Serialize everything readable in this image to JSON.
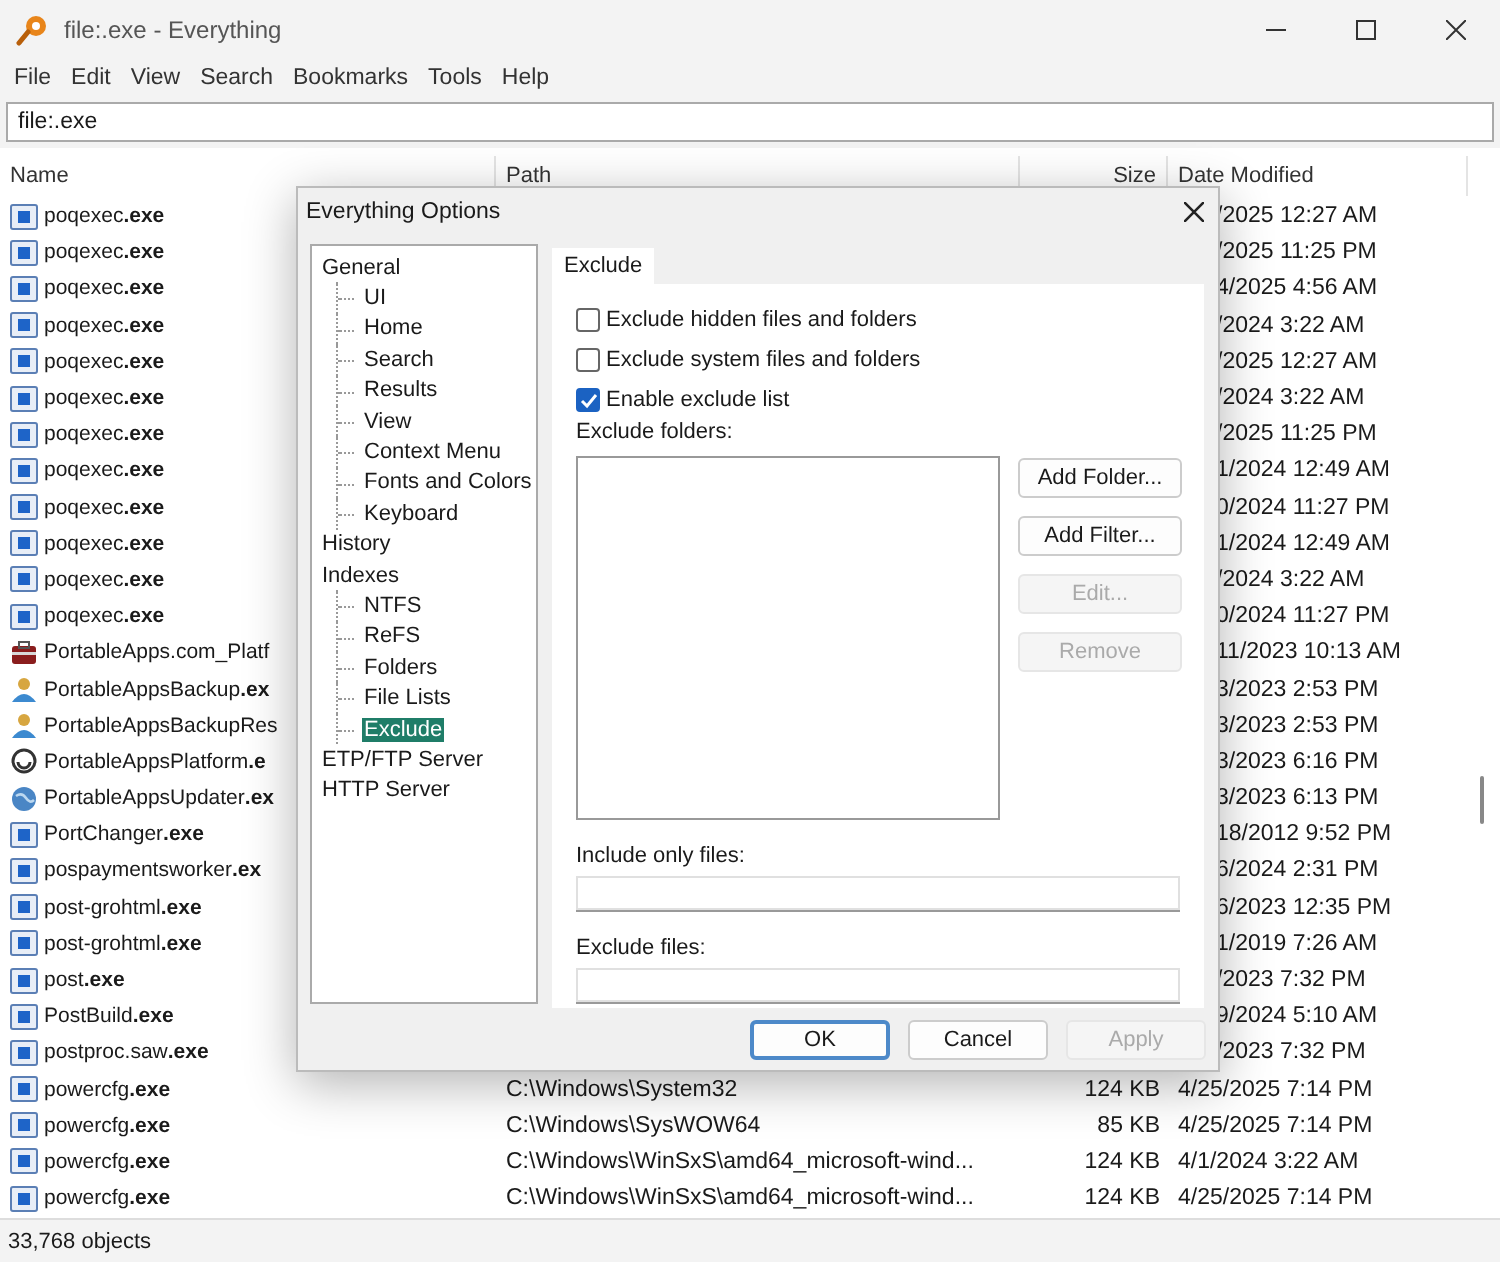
{
  "window": {
    "title": "file:.exe - Everything"
  },
  "menu": [
    "File",
    "Edit",
    "View",
    "Search",
    "Bookmarks",
    "Tools",
    "Help"
  ],
  "search": {
    "value": "file:.exe"
  },
  "columns": [
    "Name",
    "Path",
    "Size",
    "Date Modified"
  ],
  "rows": [
    {
      "kind": "exe",
      "name": "poqexec**.exe**",
      "date": "/2025 12:27 AM"
    },
    {
      "kind": "exe",
      "name": "poqexec**.exe**",
      "date": "/2025 11:25 PM"
    },
    {
      "kind": "exe",
      "name": "poqexec**.exe**",
      "date": "4/2025 4:56 AM"
    },
    {
      "kind": "exe",
      "name": "poqexec**.exe**",
      "date": "/2024 3:22 AM"
    },
    {
      "kind": "exe",
      "name": "poqexec**.exe**",
      "date": "/2025 12:27 AM"
    },
    {
      "kind": "exe",
      "name": "poqexec**.exe**",
      "date": "/2024 3:22 AM"
    },
    {
      "kind": "exe",
      "name": "poqexec**.exe**",
      "date": "/2025 11:25 PM"
    },
    {
      "kind": "exe",
      "name": "poqexec**.exe**",
      "date": "1/2024 12:49 AM"
    },
    {
      "kind": "exe",
      "name": "poqexec**.exe**",
      "date": "0/2024 11:27 PM"
    },
    {
      "kind": "exe",
      "name": "poqexec**.exe**",
      "date": "1/2024 12:49 AM"
    },
    {
      "kind": "exe",
      "name": "poqexec**.exe**",
      "date": "/2024 3:22 AM"
    },
    {
      "kind": "exe",
      "name": "poqexec**.exe**",
      "date": "0/2024 11:27 PM"
    },
    {
      "kind": "suitcase",
      "name": "PortableApps.com_Platf",
      "date": "11/2023 10:13 AM"
    },
    {
      "kind": "person",
      "name": "PortableAppsBackup**.ex**",
      "date": "3/2023 2:53 PM"
    },
    {
      "kind": "person",
      "name": "PortableAppsBackupRes",
      "date": "3/2023 2:53 PM"
    },
    {
      "kind": "ring",
      "name": "PortableAppsPlatform**.e**",
      "date": "3/2023 6:16 PM"
    },
    {
      "kind": "globe",
      "name": "PortableAppsUpdater**.ex**",
      "date": "3/2023 6:13 PM"
    },
    {
      "kind": "exe",
      "name": "PortChanger**.exe**",
      "date": "18/2012 9:52 PM"
    },
    {
      "kind": "exe",
      "name": "pospaymentsworker**.ex**",
      "date": "6/2024 2:31 PM"
    },
    {
      "kind": "exe",
      "name": "post-grohtml**.exe**",
      "date": "6/2023 12:35 PM"
    },
    {
      "kind": "exe",
      "name": "post-grohtml**.exe**",
      "date": "1/2019 7:26 AM"
    },
    {
      "kind": "exe",
      "name": "post**.exe**",
      "date": "/2023 7:32 PM"
    },
    {
      "kind": "exe",
      "name": "PostBuild**.exe**",
      "date": "9/2024 5:10 AM"
    },
    {
      "kind": "exe",
      "name": "postproc.saw**.exe**",
      "date": "/2023 7:32 PM"
    },
    {
      "kind": "exe",
      "name": "powercfg**.exe**",
      "path": "C:\\Windows\\System32",
      "size": "124 KB",
      "date": "4/25/2025 7:14 PM"
    },
    {
      "kind": "exe",
      "name": "powercfg**.exe**",
      "path": "C:\\Windows\\SysWOW64",
      "size": "85 KB",
      "date": "4/25/2025 7:14 PM"
    },
    {
      "kind": "exe",
      "name": "powercfg**.exe**",
      "path": "C:\\Windows\\WinSxS\\amd64_microsoft-wind...",
      "size": "124 KB",
      "date": "4/1/2024 3:22 AM"
    },
    {
      "kind": "exe",
      "name": "powercfg**.exe**",
      "path": "C:\\Windows\\WinSxS\\amd64_microsoft-wind...",
      "size": "124 KB",
      "date": "4/25/2025 7:14 PM"
    }
  ],
  "status_bar": "33,768 objects",
  "dialog": {
    "title": "Everything Options",
    "tree": [
      {
        "label": "General",
        "selected": false,
        "children": [
          {
            "label": "UI",
            "selected": false
          },
          {
            "label": "Home",
            "selected": false
          },
          {
            "label": "Search",
            "selected": false
          },
          {
            "label": "Results",
            "selected": false
          },
          {
            "label": "View",
            "selected": false
          },
          {
            "label": "Context Menu",
            "selected": false
          },
          {
            "label": "Fonts and Colors",
            "selected": false
          },
          {
            "label": "Keyboard",
            "selected": false
          }
        ]
      },
      {
        "label": "History",
        "selected": false
      },
      {
        "label": "Indexes",
        "selected": false,
        "children": [
          {
            "label": "NTFS",
            "selected": false
          },
          {
            "label": "ReFS",
            "selected": false
          },
          {
            "label": "Folders",
            "selected": false
          },
          {
            "label": "File Lists",
            "selected": false
          },
          {
            "label": "Exclude",
            "selected": true
          }
        ]
      },
      {
        "label": "ETP/FTP Server",
        "selected": false
      },
      {
        "label": "HTTP Server",
        "selected": false
      }
    ],
    "tab": "Exclude",
    "checkboxes": [
      {
        "label": "Exclude hidden files and folders",
        "checked": false
      },
      {
        "label": "Exclude system files and folders",
        "checked": false
      },
      {
        "label": "Enable exclude list",
        "checked": true
      }
    ],
    "exclude_folders_label": "Exclude folders:",
    "side_buttons": [
      {
        "label": "Add Folder...",
        "disabled": false
      },
      {
        "label": "Add Filter...",
        "disabled": false
      },
      {
        "label": "Edit...",
        "disabled": true
      },
      {
        "label": "Remove",
        "disabled": true
      }
    ],
    "include_only_label": "Include only files:",
    "exclude_files_label": "Exclude files:",
    "buttons": [
      {
        "label": "OK",
        "disabled": false,
        "default": true
      },
      {
        "label": "Cancel",
        "disabled": false,
        "default": false
      },
      {
        "label": "Apply",
        "disabled": true,
        "default": false
      }
    ]
  }
}
